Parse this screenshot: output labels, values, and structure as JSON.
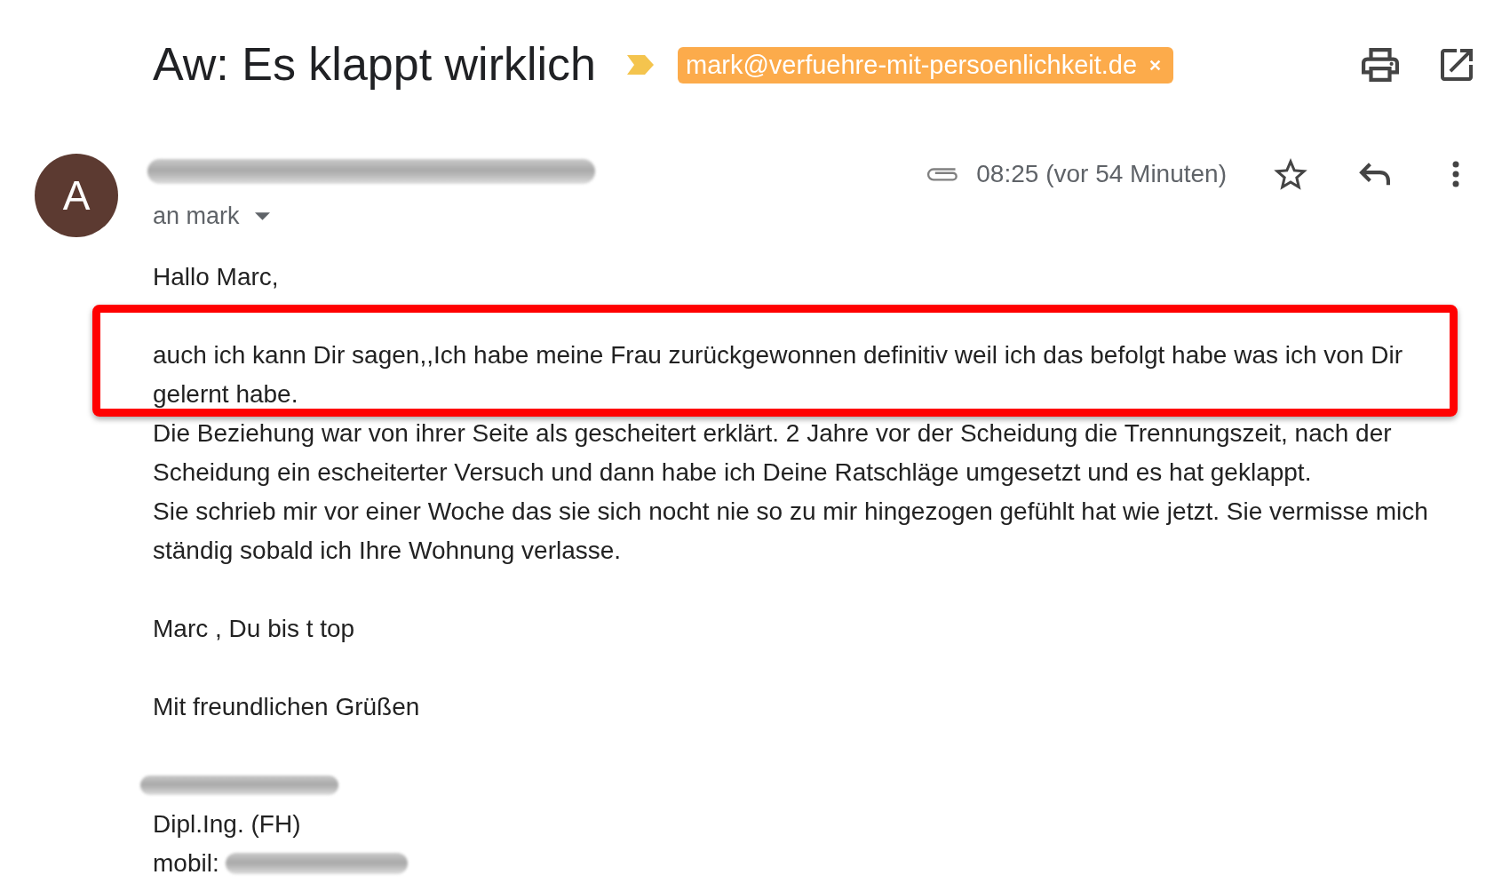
{
  "thread": {
    "subject": "Aw: Es klappt wirklich",
    "important": true,
    "labels": [
      {
        "text": "mark@verfuehre-mit-persoenlichkeit.de"
      }
    ]
  },
  "message": {
    "sender": {
      "avatar_letter": "A",
      "name_redacted": true
    },
    "recipient": "an mark",
    "has_attachment": true,
    "time": "08:25 (vor 54 Minuten)",
    "starred": false,
    "body": [
      {
        "lines": [
          {
            "kind": "text",
            "text": "Hallo Marc,",
            "highlighted": false
          }
        ]
      },
      {
        "lines": [
          {
            "kind": "text",
            "text": "auch ich kann Dir sagen,,Ich habe meine Frau zurückgewonnen definitiv weil ich das befolgt habe was ich von Dir gelernt habe.",
            "highlighted": true
          },
          {
            "kind": "text",
            "text": "Die Beziehung war von ihrer Seite als gescheitert erklärt. 2 Jahre vor der Scheidung die Trennungszeit, nach der Scheidung ein escheiterter Versuch und dann habe ich Deine Ratschläge umgesetzt und es hat geklappt.",
            "highlighted": false
          },
          {
            "kind": "text",
            "text": "Sie schrieb mir vor einer Woche das sie sich nocht nie so zu mir hingezogen gefühlt hat wie jetzt. Sie vermisse mich ständig sobald ich Ihre Wohnung verlasse.",
            "highlighted": false
          }
        ]
      },
      {
        "lines": [
          {
            "kind": "text",
            "text": "Marc , Du bis t top",
            "highlighted": false
          }
        ]
      },
      {
        "lines": [
          {
            "kind": "text",
            "text": "Mit freundlichen Grüßen",
            "highlighted": false
          }
        ]
      },
      {
        "lines": [
          {
            "kind": "redacted",
            "highlighted": false
          },
          {
            "kind": "text",
            "text": "Dipl.Ing. (FH)",
            "highlighted": false
          },
          {
            "kind": "text_redacted",
            "text": "mobil:",
            "highlighted": false
          }
        ]
      }
    ]
  }
}
